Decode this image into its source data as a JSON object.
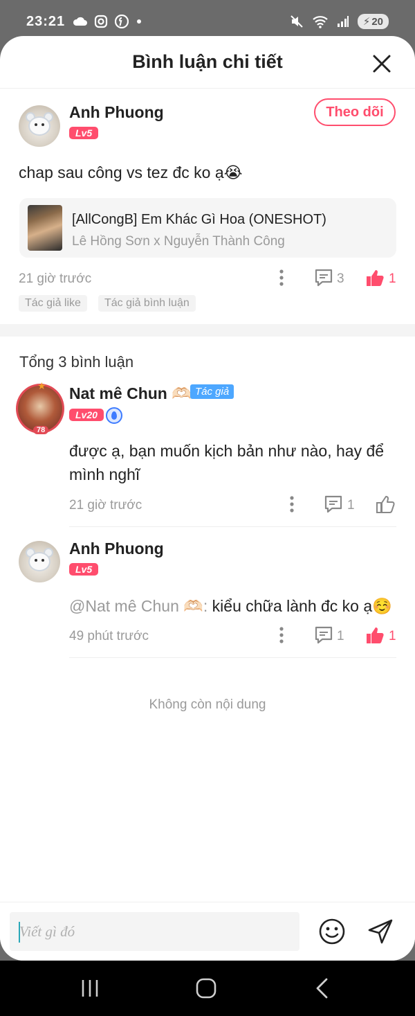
{
  "status": {
    "time": "23:21",
    "battery": "20"
  },
  "header": {
    "title": "Bình luận chi tiết"
  },
  "main_comment": {
    "user": "Anh Phuong",
    "level": "Lv5",
    "follow_label": "Theo dõi",
    "text": "chap sau công vs tez đc ko ạ😭",
    "story": {
      "title": "[AllCongB] Em Khác Gì Hoa (ONESHOT)",
      "authors": "Lê Hồng Sơn x Nguyễn Thành Công"
    },
    "time": "21 giờ trước",
    "reply_count": "3",
    "like_count": "1",
    "chips": [
      "Tác giả like",
      "Tác giả bình luận"
    ]
  },
  "replies_title": "Tổng 3 bình luận",
  "replies": [
    {
      "user": "Nat mê Chun 🫶🏻",
      "author_tag": "Tác giả",
      "level": "Lv20",
      "avatar_badge": "78",
      "text_line1": "được ạ, bạn muốn kịch bản như nào, hay để",
      "text_line2": "mình nghĩ",
      "time": "21 giờ trước",
      "reply_count": "1"
    },
    {
      "user": "Anh Phuong",
      "level": "Lv5",
      "mention": "@Nat mê Chun 🫶🏻:",
      "text": " kiểu chữa lành đc ko ạ☺️",
      "time": "49 phút trước",
      "reply_count": "1",
      "like_count": "1"
    }
  ],
  "end_text": "Không còn nội dung",
  "input": {
    "placeholder": "Viết gì đó"
  },
  "icons": {
    "close": "close-icon",
    "more": "more-vertical-icon",
    "comment": "comment-icon",
    "like": "thumbs-up-icon",
    "emoji": "emoji-icon",
    "send": "send-icon"
  },
  "colors": {
    "accent": "#ff4d6d",
    "author_tag": "#4da7ff"
  }
}
